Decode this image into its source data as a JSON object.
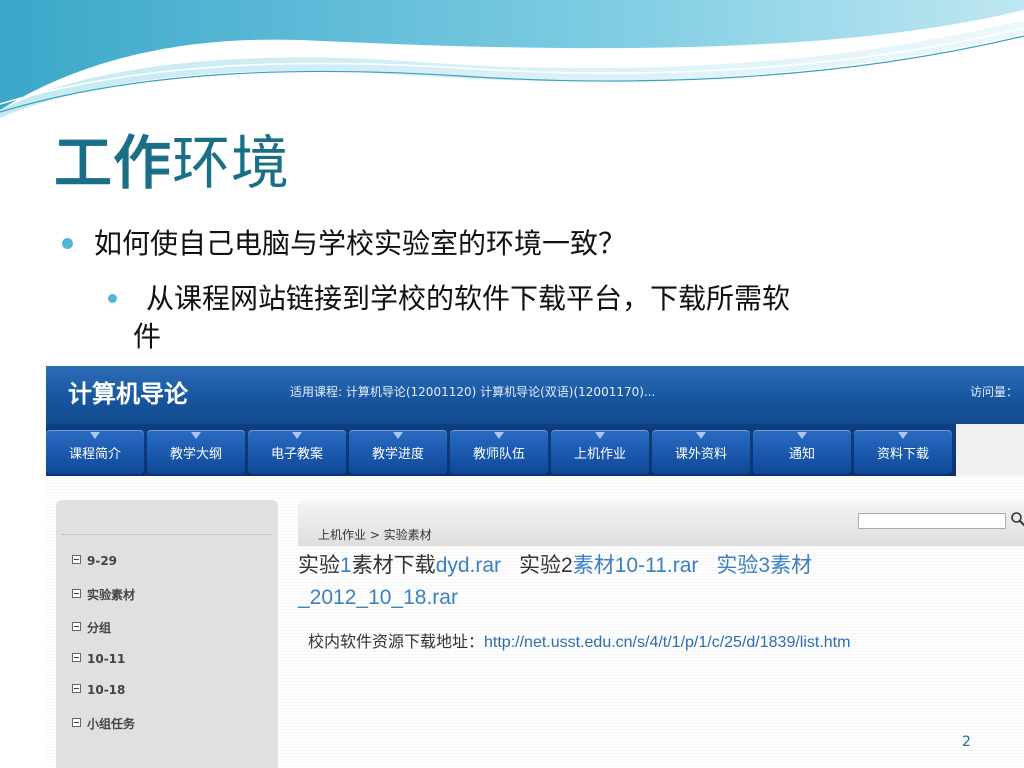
{
  "slide": {
    "title_bold": "工作",
    "title_rest": "环境",
    "bullet1": "如何使自己电脑与学校实验室的环境一致？",
    "bullet2_line1": "从课程网站链接到学校的软件下载平台，下载所需软",
    "bullet2_line2": "件",
    "page_number": "2",
    "accent_color": "#1a6f86",
    "bullet_color": "#4fb6d6"
  },
  "site": {
    "title": "计算机导论",
    "courses": "适用课程: 计算机导论(12001120) 计算机导论(双语)(12001170)...",
    "visits": "访问量：",
    "nav": [
      "课程简介",
      "教学大纲",
      "电子教案",
      "教学进度",
      "教师队伍",
      "上机作业",
      "课外资料",
      "通知",
      "资料下载"
    ],
    "tree": [
      "9-29",
      "实验素材",
      "分组",
      "10-11",
      "10-18",
      "小组任务"
    ],
    "breadcrumb": "上机作业 > 实验素材",
    "files": {
      "f1_a": "实验",
      "f1_b": "1",
      "f1_c": "素材下载",
      "f1_d": "dyd.rar",
      "f2_a": "实验",
      "f2_b": "2",
      "f2_c": "素材10-11.rar",
      "f3_a": "实验",
      "f3_b": "3",
      "f3_c": "素材",
      "f3_d": "_2012_10_18.rar"
    },
    "download_label": "校内软件资源下载地址：",
    "download_url": "http://net.usst.edu.cn/s/4/t/1/p/1/c/25/d/1839/list.htm"
  }
}
